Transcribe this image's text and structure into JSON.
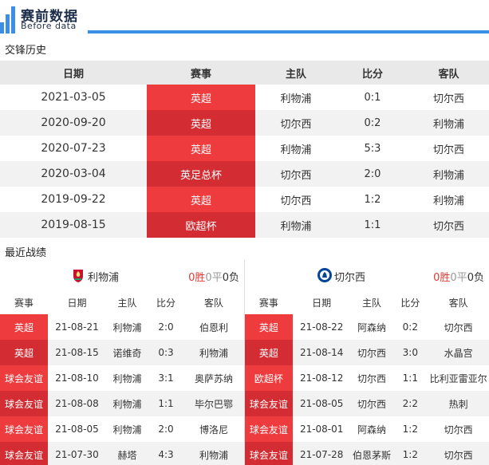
{
  "header": {
    "title": "赛前数据",
    "subtitle": "Before data"
  },
  "h2h": {
    "label": "交锋历史",
    "columns": [
      "日期",
      "赛事",
      "主队",
      "比分",
      "客队"
    ],
    "rows": [
      [
        "2021-03-05",
        "英超",
        "利物浦",
        "0:1",
        "切尔西"
      ],
      [
        "2020-09-20",
        "英超",
        "切尔西",
        "0:2",
        "利物浦"
      ],
      [
        "2020-07-23",
        "英超",
        "利物浦",
        "5:3",
        "切尔西"
      ],
      [
        "2020-03-04",
        "英足总杯",
        "切尔西",
        "2:0",
        "利物浦"
      ],
      [
        "2019-09-22",
        "英超",
        "切尔西",
        "1:2",
        "利物浦"
      ],
      [
        "2019-08-15",
        "欧超杯",
        "利物浦",
        "1:1",
        "切尔西"
      ]
    ]
  },
  "recent": {
    "label": "最近战绩",
    "columns": [
      "赛事",
      "日期",
      "主队",
      "比分",
      "客队"
    ],
    "left": {
      "team": "利物浦",
      "wins": "0",
      "win_label": "胜",
      "draws": "0",
      "draw_label": "平",
      "losses": "0",
      "loss_label": "负",
      "rows": [
        [
          "英超",
          "21-08-21",
          "利物浦",
          "2:0",
          "伯恩利"
        ],
        [
          "英超",
          "21-08-15",
          "诺维奇",
          "0:3",
          "利物浦"
        ],
        [
          "球会友谊",
          "21-08-10",
          "利物浦",
          "3:1",
          "奥萨苏纳"
        ],
        [
          "球会友谊",
          "21-08-08",
          "利物浦",
          "1:1",
          "毕尔巴鄂"
        ],
        [
          "球会友谊",
          "21-08-05",
          "利物浦",
          "2:0",
          "博洛尼"
        ],
        [
          "球会友谊",
          "21-07-30",
          "赫塔",
          "4:3",
          "利物浦"
        ]
      ]
    },
    "right": {
      "team": "切尔西",
      "wins": "0",
      "win_label": "胜",
      "draws": "0",
      "draw_label": "平",
      "losses": "0",
      "loss_label": "负",
      "rows": [
        [
          "英超",
          "21-08-22",
          "阿森纳",
          "0:2",
          "切尔西"
        ],
        [
          "英超",
          "21-08-14",
          "切尔西",
          "3:0",
          "水晶宫"
        ],
        [
          "欧超杯",
          "21-08-12",
          "切尔西",
          "1:1",
          "比利亚雷亚尔"
        ],
        [
          "球会友谊",
          "21-08-05",
          "切尔西",
          "2:2",
          "热刺"
        ],
        [
          "球会友谊",
          "21-08-01",
          "阿森纳",
          "1:2",
          "切尔西"
        ],
        [
          "球会友谊",
          "21-07-28",
          "伯恩茅斯",
          "1:2",
          "切尔西"
        ]
      ]
    }
  },
  "colors": {
    "accent_blue": "#3a8ee6",
    "comp_red": "#ee3b3e",
    "comp_red_dark": "#d32d33"
  }
}
